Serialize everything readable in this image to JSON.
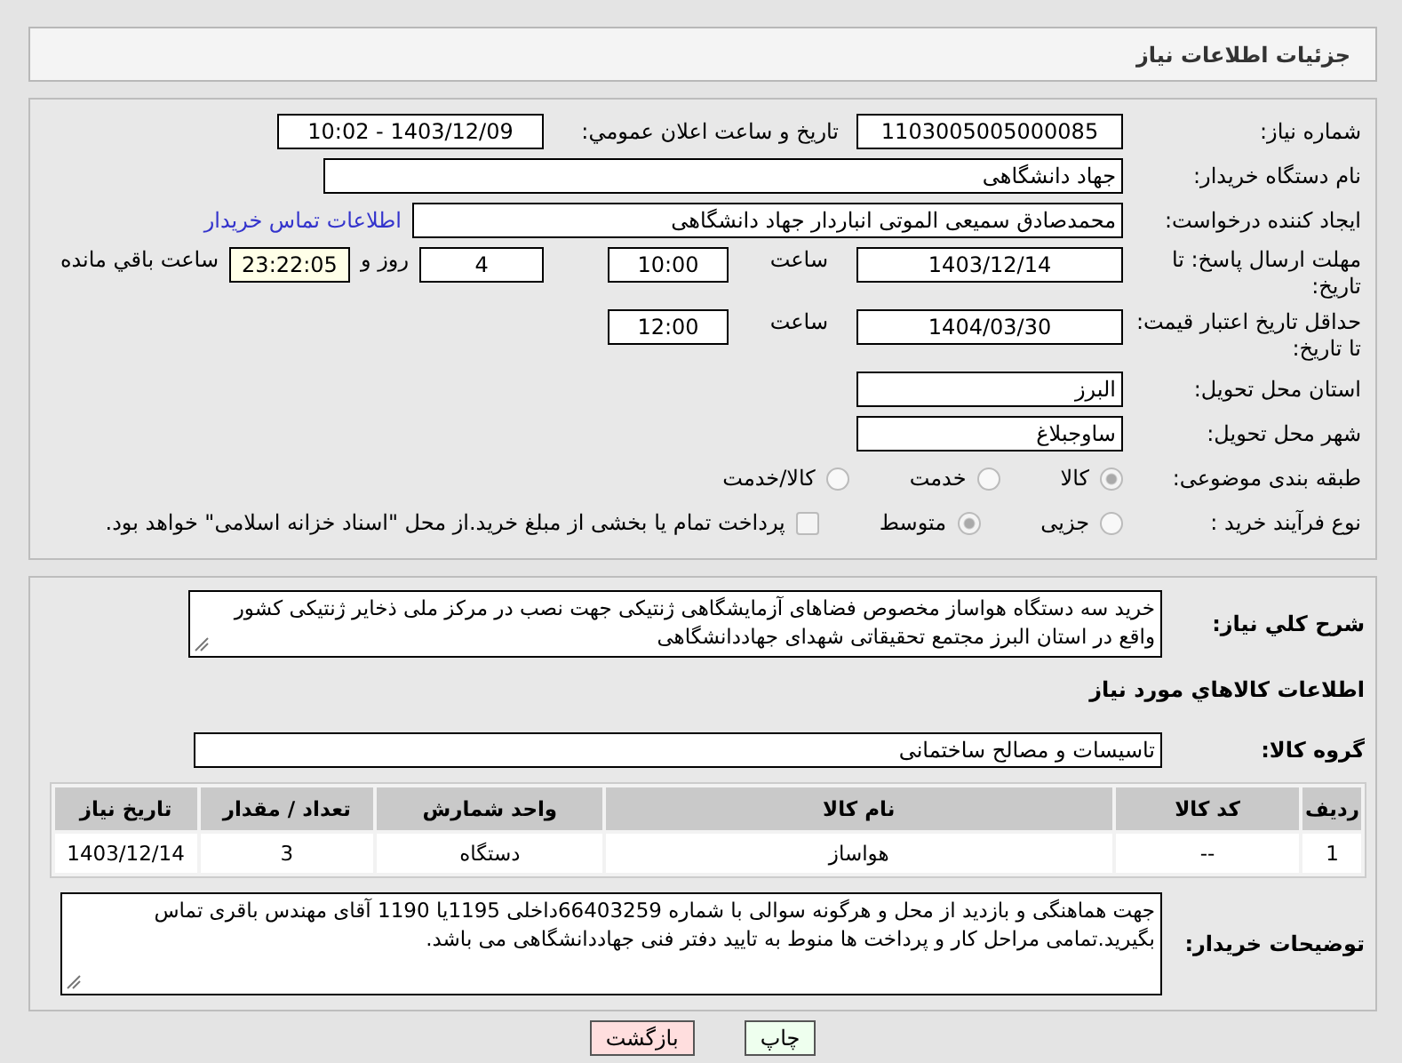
{
  "header": {
    "title": "جزئیات اطلاعات نیاز"
  },
  "need_number": {
    "label": "شماره نیاز:",
    "value": "1103005005000085"
  },
  "announce": {
    "label": "تاریخ و ساعت اعلان عمومي:",
    "value": "1403/12/09 - 10:02"
  },
  "buyer": {
    "label": "نام دستگاه خریدار:",
    "value": "جهاد دانشگاهی"
  },
  "requester": {
    "label": "ایجاد کننده درخواست:",
    "value": "محمدصادق سمیعی الموتی انباردار جهاد دانشگاهی",
    "link": "اطلاعات تماس خریدار"
  },
  "reply_deadline": {
    "label": "مهلت ارسال پاسخ: تا تاریخ:",
    "date": "1403/12/14",
    "time_label": "ساعت",
    "time": "10:00",
    "days": "4",
    "days_label": "روز و",
    "remaining": "23:22:05",
    "remaining_label": "ساعت باقي مانده"
  },
  "price_validity": {
    "label": "حداقل تاریخ اعتبار قیمت: تا تاریخ:",
    "date": "1404/03/30",
    "time_label": "ساعت",
    "time": "12:00"
  },
  "province": {
    "label": "استان محل تحویل:",
    "value": "البرز"
  },
  "city": {
    "label": "شهر محل تحویل:",
    "value": "ساوجبلاغ"
  },
  "category": {
    "label": "طبقه بندی موضوعی:",
    "options": [
      {
        "label": "کالا",
        "selected": true
      },
      {
        "label": "خدمت",
        "selected": false
      },
      {
        "label": "کالا/خدمت",
        "selected": false
      }
    ]
  },
  "process": {
    "label": "نوع فرآیند خرید :",
    "options": [
      {
        "label": "جزیی",
        "selected": false
      },
      {
        "label": "متوسط",
        "selected": true
      }
    ],
    "payment": {
      "checked": false,
      "text": "پرداخت تمام یا بخشی از مبلغ خرید.از محل \"اسناد خزانه اسلامی\" خواهد بود."
    }
  },
  "description": {
    "label": "شرح کلي نیاز:",
    "value": "خرید سه دستگاه هواساز مخصوص فضاهای آزمایشگاهی ژنتیکی جهت نصب در مرکز ملی ذخایر ژنتیکی کشور واقع در استان البرز مجتمع تحقیقاتی شهدای جهاددانشگاهی"
  },
  "goods_title": "اطلاعات کالاهاي مورد نیاز",
  "goods_group": {
    "label": "گروه کالا:",
    "value": "تاسیسات و مصالح ساختمانی"
  },
  "table": {
    "columns": [
      "ردیف",
      "کد کالا",
      "نام کالا",
      "واحد شمارش",
      "تعداد / مقدار",
      "تاریخ نیاز"
    ],
    "rows": [
      [
        "1",
        "--",
        "هواساز",
        "دستگاه",
        "3",
        "1403/12/14"
      ]
    ]
  },
  "notes": {
    "label": "توضیحات خریدار:",
    "value": "جهت هماهنگی و بازدید از محل و هرگونه سوالی با شماره 66403259داخلی 1195یا 1190 آقای مهندس باقری تماس بگیرید.تمامی مراحل کار و پرداخت ها منوط به تایید دفتر فنی جهاددانشگاهی می باشد."
  },
  "buttons": [
    {
      "kind": "print",
      "label": "چاپ"
    },
    {
      "kind": "back",
      "label": "بازگشت"
    }
  ]
}
